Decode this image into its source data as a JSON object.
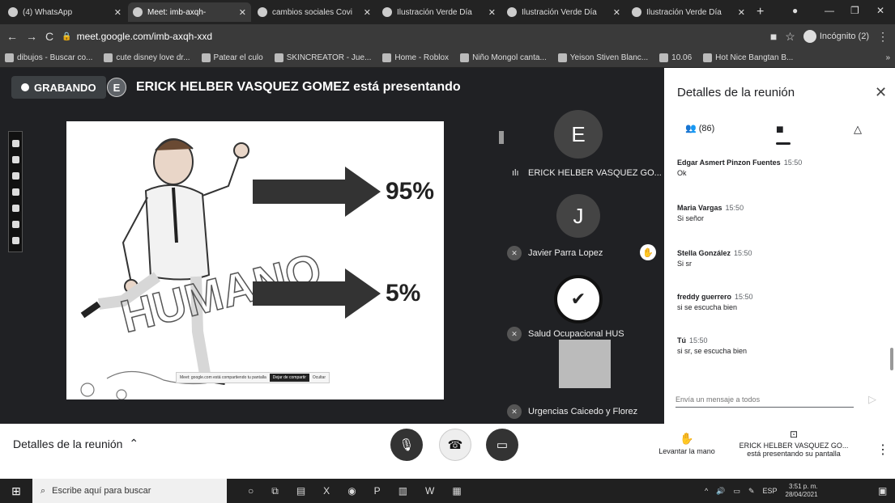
{
  "browser": {
    "tabs": [
      {
        "label": "(4) WhatsApp",
        "active": false
      },
      {
        "label": "Meet: imb-axqh-",
        "active": true
      },
      {
        "label": "cambios sociales Covi",
        "active": false
      },
      {
        "label": "Ilustración Verde Día",
        "active": false
      },
      {
        "label": "Ilustración Verde Día",
        "active": false
      },
      {
        "label": "Ilustración Verde Día",
        "active": false
      }
    ],
    "new_tab": "+",
    "address": "meet.google.com/imb-axqh-xxd",
    "profile": "Incógnito (2)",
    "bookmarks": [
      "dibujos - Buscar co...",
      "cute disney love dr...",
      "Patear el culo",
      "SKINCREATOR - Jue...",
      "Home - Roblox",
      "Niño Mongol canta...",
      "Yeison Stiven Blanc...",
      "10.06",
      "Hot Nice Bangtan B..."
    ]
  },
  "meet": {
    "recording_label": "GRABANDO",
    "presenter_initial": "E",
    "presenter_text": "ERICK HELBER VASQUEZ GOMEZ está presentando",
    "slide": {
      "word": "HUMANO",
      "upper_pct": "95%",
      "lower_pct": "5%",
      "share_note": "Meet: google.com está compartiendo tu pantalla",
      "stop_share": "Dejar de compartir",
      "hide": "Ocultar"
    },
    "participants": [
      {
        "initial": "E",
        "name": "ERICK HELBER VASQUEZ GO..."
      },
      {
        "initial": "J",
        "name": "Javier Parra Lopez"
      },
      {
        "initial": "",
        "name": "Salud Ocupacional HUS"
      },
      {
        "initial": "",
        "name": "Urgencias Caicedo y Florez"
      }
    ],
    "bottom": {
      "details_label": "Detalles de la reunión",
      "raise_hand": "Levantar la mano",
      "presenting_name": "ERICK HELBER VASQUEZ GO...",
      "presenting_text": "está presentando su pantalla"
    }
  },
  "panel": {
    "title": "Detalles de la reunión",
    "people_count": "(86)",
    "messages": [
      {
        "sender": "Edgar Asmert Pinzon Fuentes",
        "time": "15:50",
        "text": "Ok"
      },
      {
        "sender": "Maria Vargas",
        "time": "15:50",
        "text": "Si señor"
      },
      {
        "sender": "Stella González",
        "time": "15:50",
        "text": "Si sr"
      },
      {
        "sender": "freddy guerrero",
        "time": "15:50",
        "text": "si se escucha bien"
      },
      {
        "sender": "Tú",
        "time": "15:50",
        "text": "si sr, se escucha bien"
      }
    ],
    "input_placeholder": "Envía un mensaje a todos"
  },
  "taskbar": {
    "search_placeholder": "Escribe aquí para buscar",
    "language": "ESP",
    "time": "3:51 p. m.",
    "date": "28/04/2021"
  },
  "colors": {
    "meet_bg": "#202124",
    "end_call": "#eeeeee",
    "muted_btn": "#333333"
  }
}
